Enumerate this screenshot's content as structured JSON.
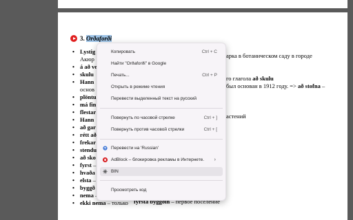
{
  "heading": {
    "number": "3.",
    "word": "Orðaforði"
  },
  "doc_lines": [
    {
      "bold": "Lystig",
      "rest": ""
    },
    {
      "bold": "",
      "rest": "Акюр",
      "cont": true
    },
    {
      "bold": "á að ve",
      "rest": ""
    },
    {
      "bold": "skulu",
      "rest": ""
    },
    {
      "bold": "Hann",
      "rest": ""
    },
    {
      "bold": "",
      "rest": "основ",
      "cont": true
    },
    {
      "bold": "plöntu",
      "rest": ""
    },
    {
      "bold": "má fin",
      "rest": ""
    },
    {
      "bold": "flestar",
      "rest": ""
    },
    {
      "bold": "Hann",
      "rest": ""
    },
    {
      "bold": "að gar",
      "rest": ""
    },
    {
      "bold": "rétt að",
      "rest": ""
    },
    {
      "bold": "frekar",
      "rest": ""
    },
    {
      "bold": "stendu",
      "rest": ""
    },
    {
      "bold": "að sko",
      "rest": ""
    },
    {
      "bold": "fyrst",
      "rest": " –"
    },
    {
      "bold": "hvaða",
      "rest": ""
    },
    {
      "bold": "elsta",
      "rest": " –"
    },
    {
      "bold": "byggð",
      "rest": " f. – поселение => "
    },
    {
      "bold": "nema",
      "rest": " – кроме"
    },
    {
      "bold": "ekki nema",
      "rest": " – только"
    }
  ],
  "behind_text": {
    "line1": "арка в ботаническом саду в городе",
    "line2": "го глагола ",
    "line2_bold": "að skulu",
    "line3": " был основан в 1912 году. => ",
    "line3_bold": "að stofna",
    "line3_end": " –",
    "line4": "астений",
    "byggd_bold": "fyrsta byggðin",
    "byggd_end": " – первое поселение"
  },
  "menu": {
    "items": [
      {
        "label": "Копировать",
        "shortcut": "Ctrl + C",
        "icon": ""
      },
      {
        "label": "Найти \"Orðaforði\" в Google",
        "shortcut": "",
        "icon": ""
      },
      {
        "label": "Печать...",
        "shortcut": "Ctrl + P",
        "icon": ""
      },
      {
        "label": "Открыть в режиме чтения",
        "shortcut": "",
        "icon": ""
      },
      {
        "label": "Перевести выделенный текст на русский",
        "shortcut": "",
        "icon": ""
      },
      {
        "label": "Повернуть по часовой стрелке",
        "shortcut": "Ctrl + ]",
        "icon": ""
      },
      {
        "label": "Повернуть против часовой стрелки",
        "shortcut": "Ctrl + [",
        "icon": ""
      },
      {
        "label": "Перевести на 'Russian'",
        "shortcut": "",
        "icon": "translate-icon"
      },
      {
        "label": "AdBlock – блокировка рекламы в Интернете.",
        "shortcut": "",
        "icon": "adblock-icon"
      },
      {
        "label": "BIN",
        "shortcut": "",
        "icon": "bin-extension-icon"
      },
      {
        "label": "Просмотреть код",
        "shortcut": "",
        "icon": ""
      }
    ],
    "submenu_arrow": "›"
  },
  "colors": {
    "selection": "#9ec3e6",
    "menu_bg": "#f7f4f8",
    "hover": "#e6e3e8",
    "adblock_red": "#d9262a",
    "viewer_bg": "#5a5a5a"
  }
}
